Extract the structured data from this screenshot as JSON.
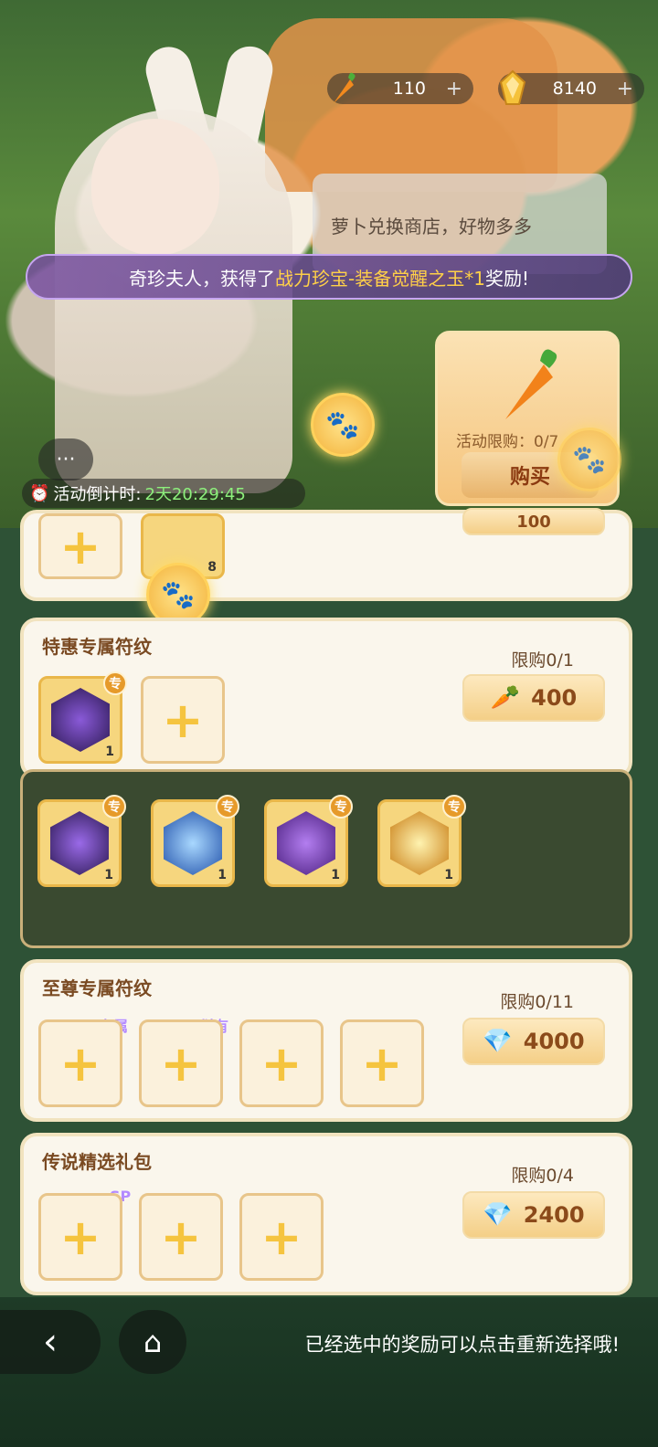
{
  "currency": {
    "carrot": {
      "icon": "carrot-icon",
      "value": "110",
      "plus": "+"
    },
    "gem": {
      "icon": "gold-gem-icon",
      "value": "8140",
      "plus": "+"
    }
  },
  "speech": "萝卜兑换商店，好物多多",
  "marquee": {
    "prefix": "奇珍夫人，获得了",
    "highlight": "战力珍宝-装备觉醒之玉*1",
    "suffix": "奖励!"
  },
  "featured": {
    "limit": "活动限购：0/7",
    "buy_label": "购买"
  },
  "countdown": {
    "label": "活动倒计时:",
    "time": "2天20:29:45"
  },
  "partial_card": {
    "count": "8",
    "price": "100"
  },
  "sections": {
    "special": {
      "title": "特惠专属符纹",
      "limit": "限购0/1",
      "price": "400",
      "price_icon": "carrot-icon",
      "selected_count": "1",
      "badge": "专"
    },
    "options": [
      {
        "name": "purple-feather-rune",
        "count": "1",
        "badge": "专",
        "color": "#4b2f7a"
      },
      {
        "name": "ice-crystal-rune",
        "count": "1",
        "badge": "专",
        "color": "#2d5fb8"
      },
      {
        "name": "purple-dragon-rune",
        "count": "1",
        "badge": "专",
        "color": "#6d3aa3"
      },
      {
        "name": "golden-burst-rune",
        "count": "1",
        "badge": "专",
        "color": "#d99a1e"
      }
    ],
    "supreme": {
      "title": "至尊专属符纹",
      "limit": "限购0/11",
      "price": "4000",
      "price_icon": "gold-gem-icon",
      "tag1": "专属",
      "tag2": "稀有"
    },
    "legend": {
      "title": "传说精选礼包",
      "limit": "限购0/4",
      "price": "2400",
      "price_icon": "gold-gem-icon",
      "tag1": "SP"
    }
  },
  "bottom": {
    "tip": "已经选中的奖励可以点击重新选择哦!"
  },
  "colors": {
    "accent": "#f5c43f",
    "highlight": "#ffd048",
    "countdown": "#8df07c"
  }
}
